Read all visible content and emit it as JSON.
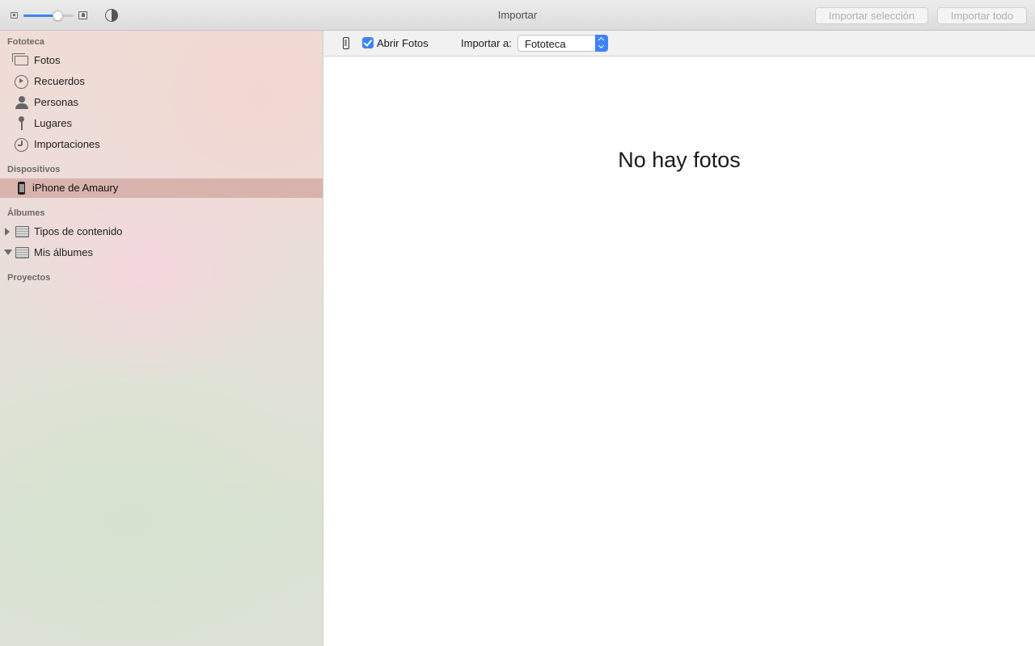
{
  "window": {
    "title": "Importar"
  },
  "toolbar": {
    "zoom_slider_level": 0.68,
    "import_selection_label": "Importar selección",
    "import_all_label": "Importar todo"
  },
  "sidebar": {
    "sections": {
      "library": "Fototeca",
      "devices": "Dispositivos",
      "albums": "Álbumes",
      "projects": "Proyectos"
    },
    "library_items": [
      {
        "label": "Fotos",
        "icon": "photos-icon"
      },
      {
        "label": "Recuerdos",
        "icon": "memories-icon"
      },
      {
        "label": "Personas",
        "icon": "people-icon"
      },
      {
        "label": "Lugares",
        "icon": "places-icon"
      },
      {
        "label": "Importaciones",
        "icon": "imports-icon"
      }
    ],
    "device_items": [
      {
        "label": "iPhone de Amaury",
        "icon": "iphone-icon",
        "selected": true
      }
    ],
    "album_items": [
      {
        "label": "Tipos de contenido",
        "icon": "folder-icon",
        "expanded": false
      },
      {
        "label": "Mis álbumes",
        "icon": "folder-icon",
        "expanded": true
      }
    ]
  },
  "import_bar": {
    "open_photos_checked": true,
    "open_photos_label": "Abrir Fotos",
    "import_to_label": "Importar a:",
    "import_to_value": "Fototeca"
  },
  "main": {
    "empty_message": "No hay fotos"
  },
  "colors": {
    "accent": "#3d83f5",
    "selection": "#c7938a"
  }
}
